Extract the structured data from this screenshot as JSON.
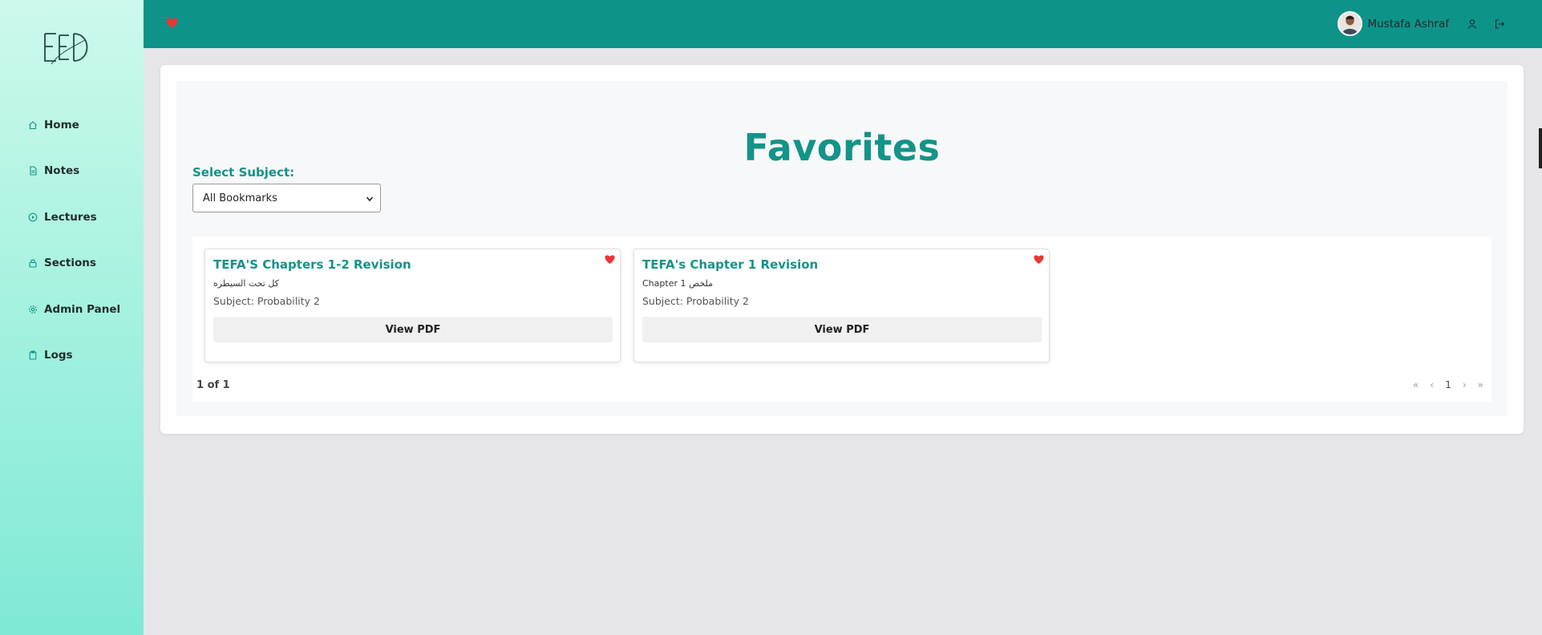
{
  "sidebar": {
    "logo_icon": "eed-logo",
    "items": [
      {
        "label": "Home",
        "icon": "home-icon"
      },
      {
        "label": "Notes",
        "icon": "document-icon"
      },
      {
        "label": "Lectures",
        "icon": "play-circle-icon"
      },
      {
        "label": "Sections",
        "icon": "lock-icon"
      },
      {
        "label": "Admin Panel",
        "icon": "gear-icon"
      },
      {
        "label": "Logs",
        "icon": "clipboard-icon"
      }
    ]
  },
  "topbar": {
    "favorites_icon": "heart-icon",
    "user_name": "Mustafa Ashraf",
    "profile_icon": "user-icon",
    "logout_icon": "logout-icon"
  },
  "main": {
    "title": "Favorites",
    "select_label": "Select Subject:",
    "select_value": "All Bookmarks",
    "cards": [
      {
        "title": "TEFA'S Chapters 1-2 Revision",
        "description": "كل تحت السيطره",
        "subject": "Subject: Probability 2",
        "button": "View PDF"
      },
      {
        "title": "TEFA's Chapter 1 Revision",
        "description": "Chapter 1 ملخص",
        "subject": "Subject: Probability 2",
        "button": "View PDF"
      }
    ],
    "pagination": {
      "info": "1 of 1",
      "first": "«",
      "prev": "‹",
      "current": "1",
      "next": "›",
      "last": "»"
    }
  },
  "colors": {
    "primary": "#0e9389",
    "accent_text": "#139488",
    "heart": "#e53935",
    "sidebar_top": "#cdf9ec",
    "sidebar_bottom": "#7fe9d6"
  }
}
